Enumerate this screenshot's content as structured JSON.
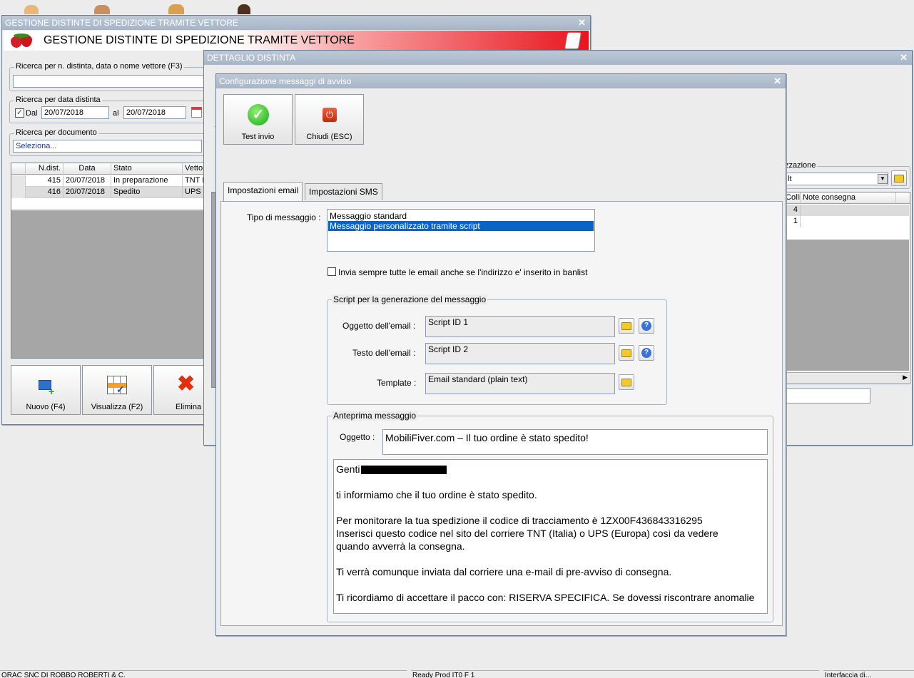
{
  "win_main": {
    "title": "GESTIONE DISTINTE DI SPEDIZIONE TRAMITE VETTORE",
    "banner": "GESTIONE DISTINTE DI SPEDIZIONE TRAMITE VETTORE",
    "search_label": "Ricerca per n. distinta, data o nome vettore (F3)",
    "search_value": "",
    "date_group": "Ricerca per data distinta",
    "dal_label": "Dal",
    "date_from": "20/07/2018",
    "al_label": "al",
    "date_to": "20/07/2018",
    "doc_group": "Ricerca per documento",
    "doc_value": "Seleziona...",
    "columns": [
      "N.dist.",
      "Data",
      "Stato",
      "Vettor"
    ],
    "rows": [
      {
        "n": "415",
        "data": "20/07/2018",
        "stato": "In preparazione",
        "vettore": "TNT I"
      },
      {
        "n": "416",
        "data": "20/07/2018",
        "stato": "Spedito",
        "vettore": "UPS"
      }
    ],
    "buttons": {
      "nuovo": "Nuovo (F4)",
      "visualizza": "Visualizza (F2)",
      "elimina": "Elimina"
    }
  },
  "win_detail": {
    "title": "DETTAGLIO DISTINTA",
    "group_label": "zzazione",
    "combo_value": "lt",
    "columns": [
      "Colli",
      "Note consegna"
    ],
    "rows": [
      {
        "colli": "4"
      },
      {
        "colli": "1"
      }
    ]
  },
  "dialog": {
    "title": "Configurazione messaggi di avviso",
    "btn_test": "Test invio",
    "btn_close": "Chiudi (ESC)",
    "tabs": [
      "Impostazioni email",
      "Impostazioni SMS"
    ],
    "tipo_label": "Tipo di messaggio :",
    "tipo_options": [
      "Messaggio standard",
      "Messaggio personalizzato tramite script"
    ],
    "banlist_label": "Invia sempre tutte le email anche se l'indirizzo e' inserito in banlist",
    "script_group": "Script per la generazione del messaggio",
    "oggetto_email_label": "Oggetto dell'email :",
    "oggetto_email_value": "Script ID 1",
    "testo_email_label": "Testo dell'email :",
    "testo_email_value": "Script ID 2",
    "template_label": "Template :",
    "template_value": "Email standard (plain text)",
    "preview_group": "Anteprima messaggio",
    "oggetto_label": "Oggetto :",
    "oggetto_value": "MobiliFiver.com – Il tuo ordine è stato spedito!",
    "body_lines": [
      "Genti",
      "",
      "ti informiamo che il tuo ordine è stato spedito.",
      "",
      "Per monitorare la tua spedizione il codice di tracciamento è 1ZX00F436843316295",
      "Inserisci questo codice nel sito del corriere TNT (Italia) o UPS (Europa) così da vedere",
      "quando avverrà la consegna.",
      "",
      "Ti verrà comunque inviata dal corriere una e-mail di pre-avviso di consegna.",
      "",
      "Ti ricordiamo di accettare il pacco con: RISERVA SPECIFICA. Se dovessi riscontrare anomalie"
    ]
  },
  "statusbar": [
    "ORAC SNC DI ROBBO ROBERTI & C.",
    "Ready Prod IT0 F 1",
    "Interfaccia di..."
  ],
  "colors": {
    "title_bar": "#a7b5c7",
    "banner_red": "#e8141e",
    "selection": "#0a64c8"
  }
}
